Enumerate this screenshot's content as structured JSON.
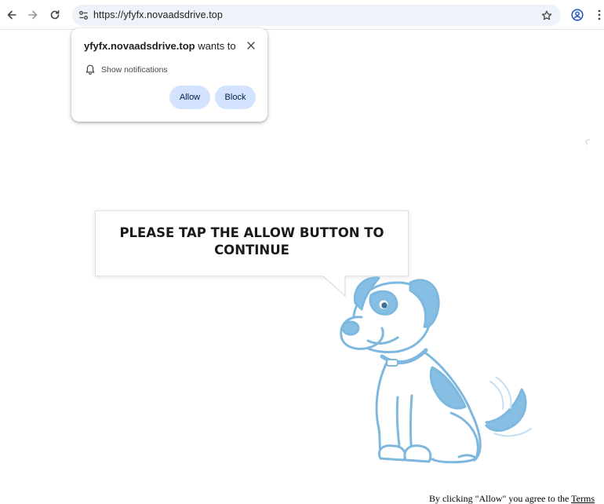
{
  "browser": {
    "url": "https://yfyfx.novaadsdrive.top",
    "icons": {
      "back": "arrow-left-icon",
      "forward": "arrow-right-icon",
      "reload": "reload-icon",
      "site_info": "tune-icon",
      "bookmark": "star-icon",
      "profile": "profile-icon",
      "menu": "more-vert-icon"
    }
  },
  "permission_popup": {
    "site": "yfyfx.novaadsdrive.top",
    "wants_to": "wants to",
    "permission": "Show notifications",
    "allow_label": "Allow",
    "block_label": "Block",
    "icons": {
      "close": "close-icon",
      "permission": "bell-icon"
    }
  },
  "page": {
    "bubble_text": "PLEASE TAP THE ALLOW BUTTON TO CONTINUE",
    "footer_text": "By clicking \"Allow\" you agree to the",
    "footer_link": "Terms",
    "illustration": "cartoon-dog",
    "colors": {
      "dog_blue": "#86bfe3",
      "dog_outline": "#7fb8de",
      "button_bg": "#d3e3fd"
    }
  }
}
